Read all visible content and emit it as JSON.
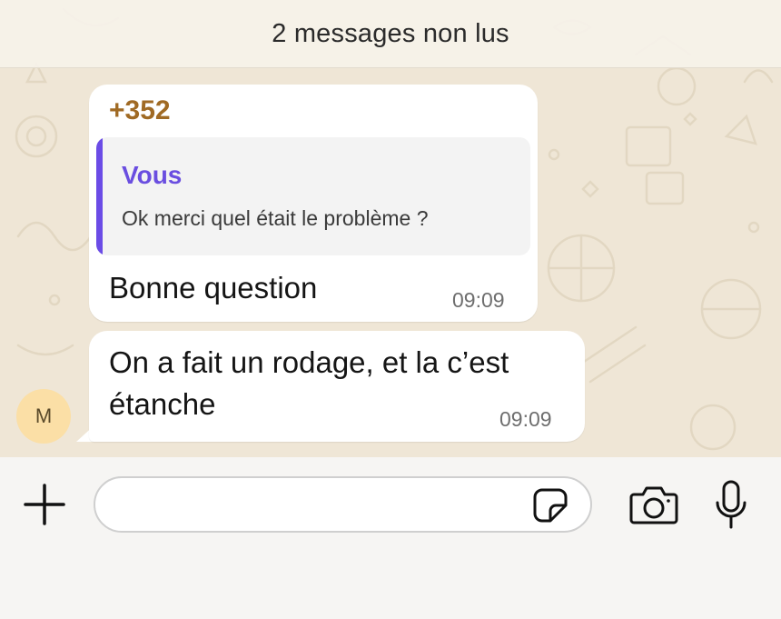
{
  "banner": {
    "unread_text": "2 messages non lus"
  },
  "messages": [
    {
      "sender": "+352",
      "reply": {
        "author": "Vous",
        "text": "Ok merci quel était le problème ?"
      },
      "text": "Bonne question",
      "time": "09:09"
    },
    {
      "text_line1": "On a fait un rodage, et la c’est",
      "text_line2": "étanche",
      "time": "09:09"
    }
  ],
  "avatar": {
    "initial": "M",
    "color": "#fbdfa6"
  },
  "composer": {
    "placeholder": "",
    "icons": [
      "plus-icon",
      "sticker-icon",
      "camera-icon",
      "microphone-icon"
    ]
  },
  "colors": {
    "sender": "#a06a24",
    "reply_author": "#6a4ee0",
    "reply_bar": "#6b4ce6",
    "wallpaper": "#efe6d6"
  }
}
